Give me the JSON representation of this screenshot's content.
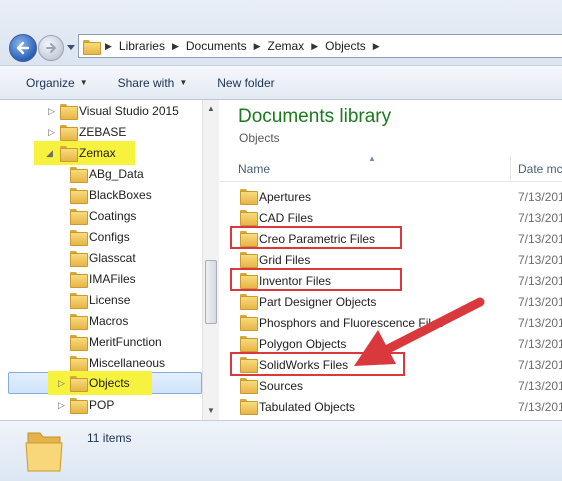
{
  "breadcrumbs": [
    "Libraries",
    "Documents",
    "Zemax",
    "Objects"
  ],
  "toolbar": {
    "organize": "Organize",
    "share_with": "Share with",
    "new_folder": "New folder"
  },
  "nav_tree": [
    {
      "label": "Visual Studio 2015",
      "arrow": "▷"
    },
    {
      "label": "ZEBASE",
      "arrow": "▷"
    },
    {
      "label": "Zemax",
      "arrow": "◢"
    },
    {
      "label": "ABg_Data",
      "arrow": ""
    },
    {
      "label": "BlackBoxes",
      "arrow": ""
    },
    {
      "label": "Coatings",
      "arrow": ""
    },
    {
      "label": "Configs",
      "arrow": ""
    },
    {
      "label": "Glasscat",
      "arrow": ""
    },
    {
      "label": "IMAFiles",
      "arrow": ""
    },
    {
      "label": "License",
      "arrow": ""
    },
    {
      "label": "Macros",
      "arrow": ""
    },
    {
      "label": "MeritFunction",
      "arrow": ""
    },
    {
      "label": "Miscellaneous",
      "arrow": ""
    },
    {
      "label": "Objects",
      "arrow": "▷"
    },
    {
      "label": "POP",
      "arrow": "▷"
    }
  ],
  "library": {
    "title": "Documents library",
    "subtitle": "Objects"
  },
  "columns": {
    "name": "Name",
    "date": "Date mc"
  },
  "files": [
    {
      "name": "Apertures",
      "date": "7/13/201"
    },
    {
      "name": "CAD Files",
      "date": "7/13/201"
    },
    {
      "name": "Creo Parametric Files",
      "date": "7/13/201"
    },
    {
      "name": "Grid Files",
      "date": "7/13/201"
    },
    {
      "name": "Inventor Files",
      "date": "7/13/201"
    },
    {
      "name": "Part Designer Objects",
      "date": "7/13/201"
    },
    {
      "name": "Phosphors and Fluorescence Files",
      "date": "7/13/201"
    },
    {
      "name": "Polygon Objects",
      "date": "7/13/201"
    },
    {
      "name": "SolidWorks Files",
      "date": "7/13/201"
    },
    {
      "name": "Sources",
      "date": "7/13/201"
    },
    {
      "name": "Tabulated Objects",
      "date": "7/13/201"
    }
  ],
  "status": {
    "count": "11 items"
  },
  "colors": {
    "title_green": "#1c7a1c",
    "highlight_yellow": "#f7f23e",
    "annotation_red": "#d9393d"
  }
}
